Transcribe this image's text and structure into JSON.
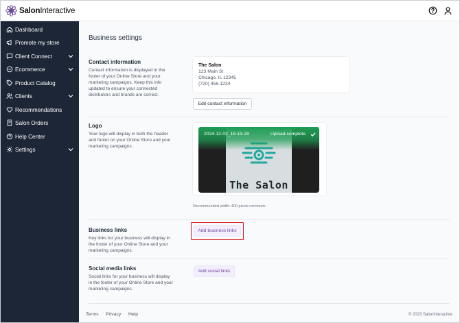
{
  "app": {
    "brand_part1": "Salon",
    "brand_part2": "Interactive"
  },
  "sidebar": {
    "items": [
      {
        "label": "Dashboard",
        "icon": "home-icon",
        "expandable": false
      },
      {
        "label": "Promote my store",
        "icon": "megaphone-icon",
        "expandable": false
      },
      {
        "label": "Client Connect",
        "icon": "chat-icon",
        "expandable": true
      },
      {
        "label": "Ecommerce",
        "icon": "cart-icon",
        "expandable": true
      },
      {
        "label": "Product Catalog",
        "icon": "tag-icon",
        "expandable": false
      },
      {
        "label": "Clients",
        "icon": "users-icon",
        "expandable": true
      },
      {
        "label": "Recommendations",
        "icon": "heart-icon",
        "expandable": false
      },
      {
        "label": "Salon Orders",
        "icon": "receipt-icon",
        "expandable": false
      },
      {
        "label": "Help Center",
        "icon": "help-icon",
        "expandable": false
      },
      {
        "label": "Settings",
        "icon": "gear-icon",
        "expandable": true
      }
    ]
  },
  "header": {
    "help_icon": "question-circle-icon",
    "user_icon": "user-icon"
  },
  "main": {
    "title": "Business settings",
    "contact": {
      "title": "Contact information",
      "description": "Contact information is displayed in the footer of your Online Store and your marketing campaigns. Keep this info updated to ensure your connected distributors and brands are correct.",
      "name": "The Salon",
      "address1": "123 Main St",
      "address2": "Chicago, IL 12345",
      "phone": "(720) 456-1234",
      "edit_label": "Edit contact information"
    },
    "logo": {
      "title": "Logo",
      "description": "Your logo will display in both the header and footer on your Online Store and your marketing campaigns.",
      "file_name": "2024-12-02_15-13-28",
      "status": "Upload complete",
      "image_text": "The Salon",
      "recommendation": "Recommended width: 400 pixels minimum."
    },
    "business_links": {
      "title": "Business links",
      "description": "Key links for your business will display in the footer of your Online Store and your marketing campaigns.",
      "button_label": "Add business links"
    },
    "social_links": {
      "title": "Social media links",
      "description": "Social links for your business will display in the footer of your Online Store and your marketing campaigns.",
      "button_label": "Add social links"
    }
  },
  "footer": {
    "terms": "Terms",
    "privacy": "Privacy",
    "help": "Help",
    "copyright": "© 2023 SalonInteractive"
  },
  "colors": {
    "sidebar": "#1d2637",
    "accent": "#6b3fa0",
    "highlight": "#e11d26",
    "upload_green": "#1f9e55",
    "logo_teal": "#20a8a0"
  }
}
